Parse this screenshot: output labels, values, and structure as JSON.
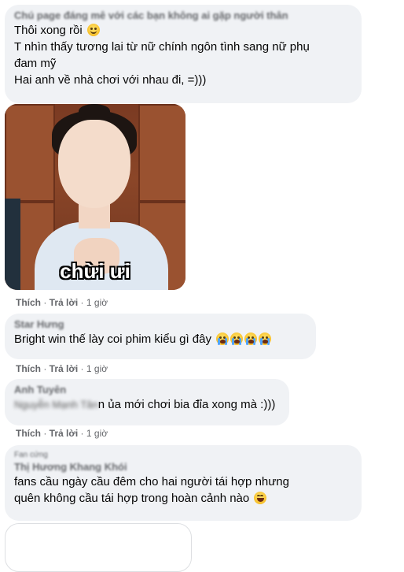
{
  "comments": [
    {
      "author": "Chú page đáng mê với các bạn không ai gặp người thân",
      "lines": [
        "Thôi xong rồi",
        "T nhìn thấy tương lai từ nữ chính ngôn tình sang nữ phụ",
        "đam mỹ",
        "Hai anh về nhà chơi với nhau đi, =)))"
      ],
      "emoji": "smile-icon",
      "sticker_caption": "chừi ưi",
      "actions": {
        "like": "Thích",
        "reply": "Trả lời",
        "time": "1 giờ"
      }
    },
    {
      "author": "Star Hưng",
      "lines": [
        "Bright win thế lày coi phim kiểu gì đây"
      ],
      "emoji": "crying-icon",
      "actions": {
        "like": "Thích",
        "reply": "Trả lời",
        "time": "1 giờ"
      }
    },
    {
      "author": "Anh Tuyên",
      "mention": "Nguyễn Mạnh Tân",
      "lines": [
        "n ủa mới chơi bia đỉa xong mà :)))"
      ],
      "actions": {
        "like": "Thích",
        "reply": "Trả lời",
        "time": "1 giờ"
      }
    },
    {
      "badge": "Fan cứng",
      "author": "Thị Hương Khang Khói",
      "lines": [
        "fans cầu ngày cầu đêm cho hai người tái hợp nhưng",
        "quên không cầu tái hợp trong hoàn cảnh nào"
      ],
      "emoji": "laughing-tears-icon"
    }
  ]
}
